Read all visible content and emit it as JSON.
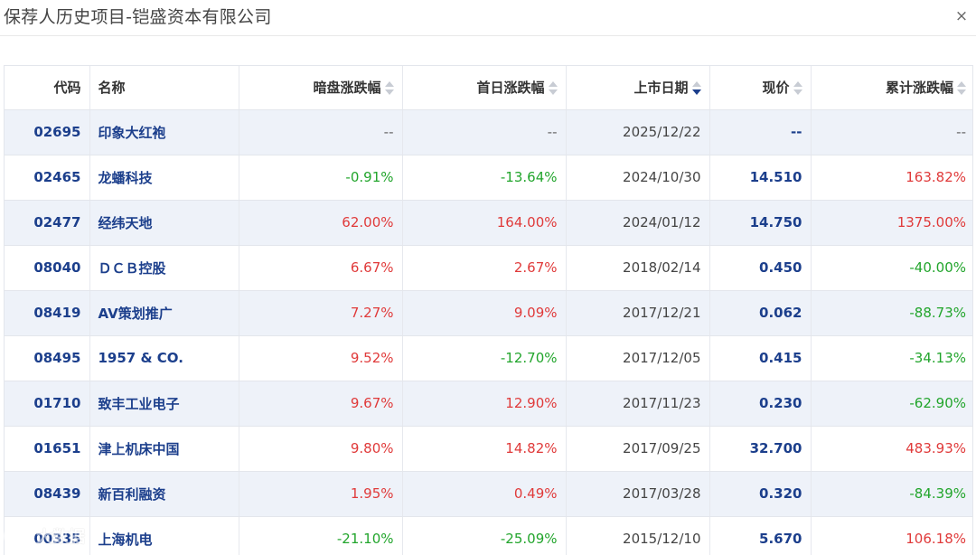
{
  "dialog": {
    "title": "保荐人历史项目-铠盛资本有限公司",
    "close_label": "×"
  },
  "table": {
    "headers": {
      "code": "代码",
      "name": "名称",
      "dark": "暗盘涨跌幅",
      "first": "首日涨跌幅",
      "date": "上市日期",
      "price": "现价",
      "total": "累计涨跌幅"
    },
    "sort_column": "date",
    "sort_order": "desc",
    "rows": [
      {
        "code": "02695",
        "name": "印象大红袍",
        "dark": "--",
        "first": "--",
        "date": "2025/12/22",
        "price": "--",
        "total": "--",
        "dark_c": "flat",
        "first_c": "flat",
        "total_c": "flat"
      },
      {
        "code": "02465",
        "name": "龙蟠科技",
        "dark": "-0.91%",
        "first": "-13.64%",
        "date": "2024/10/30",
        "price": "14.510",
        "total": "163.82%",
        "dark_c": "down",
        "first_c": "down",
        "total_c": "up"
      },
      {
        "code": "02477",
        "name": "经纬天地",
        "dark": "62.00%",
        "first": "164.00%",
        "date": "2024/01/12",
        "price": "14.750",
        "total": "1375.00%",
        "dark_c": "up",
        "first_c": "up",
        "total_c": "up"
      },
      {
        "code": "08040",
        "name": "ＤＣＢ控股",
        "dark": "6.67%",
        "first": "2.67%",
        "date": "2018/02/14",
        "price": "0.450",
        "total": "-40.00%",
        "dark_c": "up",
        "first_c": "up",
        "total_c": "down"
      },
      {
        "code": "08419",
        "name": "AV策划推广",
        "dark": "7.27%",
        "first": "9.09%",
        "date": "2017/12/21",
        "price": "0.062",
        "total": "-88.73%",
        "dark_c": "up",
        "first_c": "up",
        "total_c": "down"
      },
      {
        "code": "08495",
        "name": "1957 & CO.",
        "dark": "9.52%",
        "first": "-12.70%",
        "date": "2017/12/05",
        "price": "0.415",
        "total": "-34.13%",
        "dark_c": "up",
        "first_c": "down",
        "total_c": "down"
      },
      {
        "code": "01710",
        "name": "致丰工业电子",
        "dark": "9.67%",
        "first": "12.90%",
        "date": "2017/11/23",
        "price": "0.230",
        "total": "-62.90%",
        "dark_c": "up",
        "first_c": "up",
        "total_c": "down"
      },
      {
        "code": "01651",
        "name": "津上机床中国",
        "dark": "9.80%",
        "first": "14.82%",
        "date": "2017/09/25",
        "price": "32.700",
        "total": "483.93%",
        "dark_c": "up",
        "first_c": "up",
        "total_c": "up"
      },
      {
        "code": "08439",
        "name": "新百利融资",
        "dark": "1.95%",
        "first": "0.49%",
        "date": "2017/03/28",
        "price": "0.320",
        "total": "-84.39%",
        "dark_c": "up",
        "first_c": "up",
        "total_c": "down"
      },
      {
        "code": "00335",
        "name": "上海机电",
        "dark": "-21.10%",
        "first": "-25.09%",
        "date": "2015/12/10",
        "price": "5.670",
        "total": "106.18%",
        "dark_c": "down",
        "first_c": "down",
        "total_c": "up"
      }
    ]
  },
  "watermark": {
    "text": "大数据"
  },
  "colors": {
    "up": "#e03a3a",
    "down": "#22a52c",
    "link": "#1c3f8c",
    "stripe": "#eef2f9"
  }
}
